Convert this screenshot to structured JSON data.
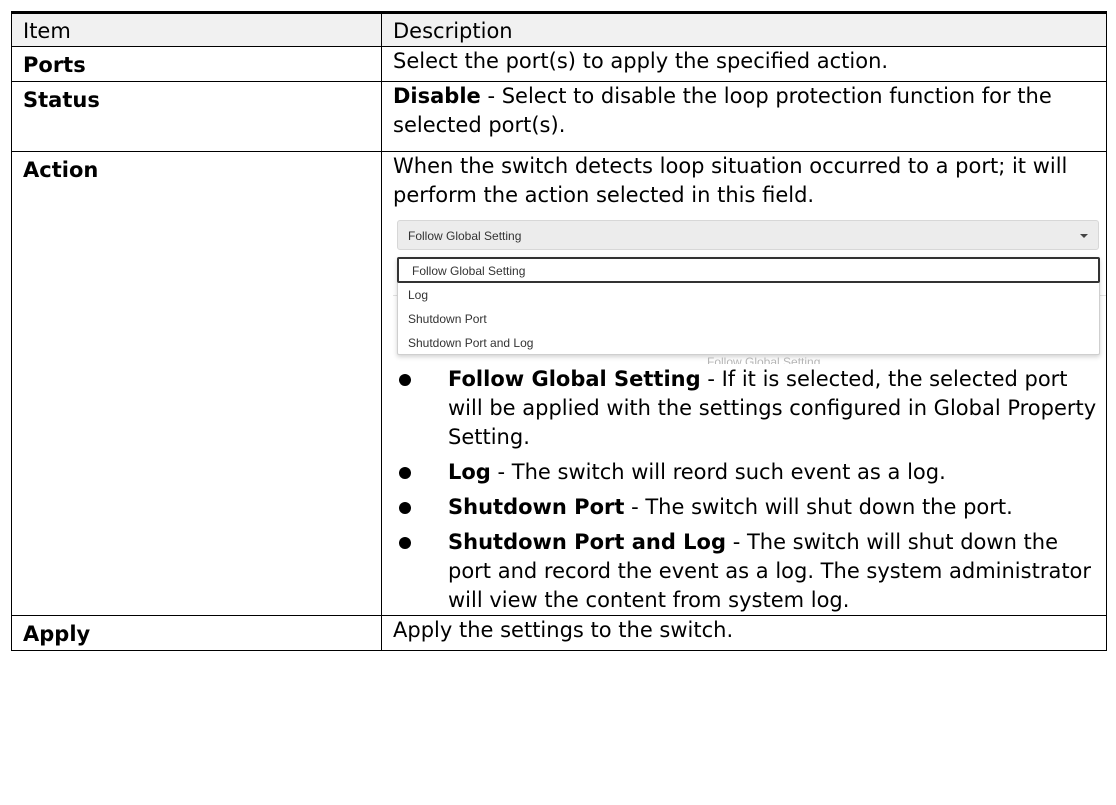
{
  "table": {
    "header": {
      "item": "Item",
      "description": "Description"
    },
    "rows": {
      "ports": {
        "item": "Ports",
        "desc": "Select the port(s) to apply the specified action."
      },
      "status": {
        "item": "Status",
        "term": "Disable",
        "desc": " - Select to disable the loop protection function for the selected port(s)."
      },
      "action": {
        "item": "Action",
        "intro": "When the switch detects loop situation occurred to a port; it will perform the action selected in this field.",
        "dropdown": {
          "selected": "Follow Global Setting",
          "options": [
            "Follow Global Setting",
            "Log",
            "Shutdown Port",
            "Shutdown Port and Log"
          ],
          "behind_text": "Follow Global Setting"
        },
        "bullets": [
          {
            "term": "Follow Global Setting",
            "text": " - If it is selected, the selected port will be applied with the settings configured in Global Property Setting."
          },
          {
            "term": "Log",
            "text": " - The switch will reord such event as a log."
          },
          {
            "term": "Shutdown Port",
            "text": " - The switch will shut down the port."
          },
          {
            "term": "Shutdown Port and Log",
            "text": " - The switch will shut down the port and record the event as a log. The system administrator will view the content from system log."
          }
        ]
      },
      "apply": {
        "item": "Apply",
        "desc": "Apply the settings to the switch."
      }
    }
  }
}
